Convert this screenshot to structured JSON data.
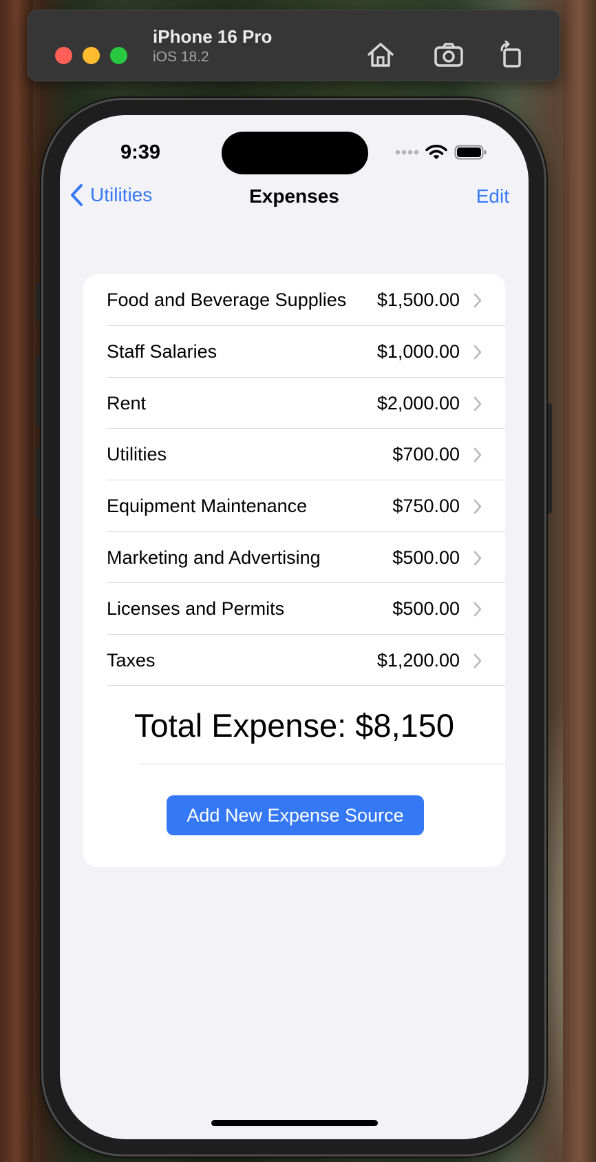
{
  "simulator": {
    "device_name": "iPhone 16 Pro",
    "os_version": "iOS 18.2",
    "toolbar_icons": [
      "home-icon",
      "screenshot-icon",
      "rotate-icon"
    ]
  },
  "status_bar": {
    "time": "9:39",
    "icons": [
      "cellular-dots-icon",
      "wifi-icon",
      "battery-icon"
    ]
  },
  "nav": {
    "back_label": "Utilities",
    "title": "Expenses",
    "edit_label": "Edit"
  },
  "expenses": [
    {
      "name": "Food and Beverage Supplies",
      "amount": "$1,500.00"
    },
    {
      "name": "Staff Salaries",
      "amount": "$1,000.00"
    },
    {
      "name": "Rent",
      "amount": "$2,000.00"
    },
    {
      "name": "Utilities",
      "amount": "$700.00"
    },
    {
      "name": "Equipment Maintenance",
      "amount": "$750.00"
    },
    {
      "name": "Marketing and Advertising",
      "amount": "$500.00"
    },
    {
      "name": "Licenses and Permits",
      "amount": "$500.00"
    },
    {
      "name": "Taxes",
      "amount": "$1,200.00"
    }
  ],
  "total_label": "Total Expense: $8,150",
  "add_button_label": "Add New Expense Source",
  "colors": {
    "accent": "#3478f6",
    "screen_background": "#f2f2f7",
    "card_background": "#ffffff"
  }
}
